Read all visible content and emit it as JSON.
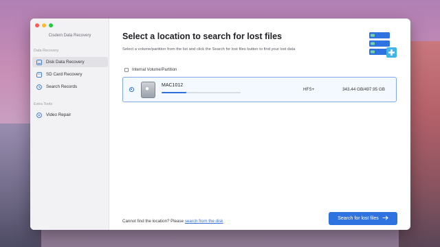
{
  "app": {
    "title": "Cisdem Data Recovery"
  },
  "sidebar": {
    "section_recovery": "Data Recovery",
    "items": [
      {
        "label": "Disk Data Recovery",
        "icon": "disk-icon",
        "active": true
      },
      {
        "label": "SD Card Recovery",
        "icon": "sd-card-icon",
        "active": false
      },
      {
        "label": "Search Records",
        "icon": "records-icon",
        "active": false
      }
    ],
    "section_tools": "Extra Tools",
    "tools": [
      {
        "label": "Video Repair",
        "icon": "video-repair-icon"
      }
    ]
  },
  "main": {
    "heading": "Select a location to search for lost files",
    "subheading": "Select a volume/partition from the list and click the Search for lost files button to find your lost data",
    "volume_header": "Internal Volume/Partition",
    "volumes": [
      {
        "name": "MAC1012",
        "filesystem": "HFS+",
        "size": "343.44 GB/497.95 GB",
        "usage_fraction": 0.31,
        "selected": true
      }
    ],
    "footer_prefix": "Cannot find the location? Please ",
    "footer_link": "search from the disk",
    "search_button": "Search for lost files",
    "search_button_icon": "arrow-right-icon"
  },
  "colors": {
    "accent": "#2f73e0",
    "selection_border": "#7fa7e6"
  }
}
